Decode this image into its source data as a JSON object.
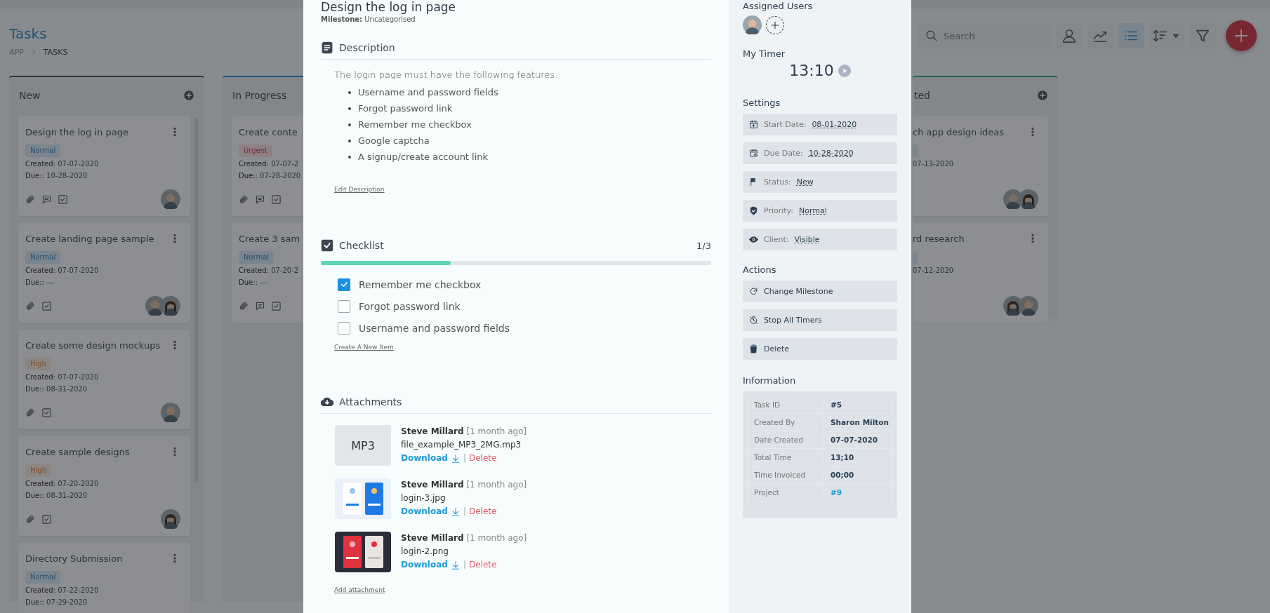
{
  "page_title": "Tasks",
  "breadcrumb": [
    {
      "label": "APP",
      "selected": false
    },
    {
      "label": "TASKS",
      "selected": true
    }
  ],
  "search": {
    "placeholder": "Search"
  },
  "view_buttons": [
    {
      "kind": "users",
      "selected": false
    },
    {
      "kind": "chart",
      "selected": false
    },
    {
      "kind": "list",
      "selected": true
    },
    {
      "kind": "sort",
      "selected": false
    },
    {
      "kind": "filter",
      "selected": false
    }
  ],
  "columns": [
    {
      "title": "New",
      "kind": "new",
      "add": true,
      "cards": [
        {
          "title": "Design the log in page",
          "menu": true,
          "tag": {
            "label": "Normal",
            "kind": "normal"
          },
          "created_label": "Created:",
          "created": "07-07-2020",
          "due_label": "Due::",
          "due": "10-28-2020",
          "attachments": true,
          "comments": true,
          "checklist": true,
          "avatars": [
            {
              "kind": "man"
            }
          ]
        },
        {
          "title": "Create landing page sample",
          "menu": true,
          "tag": {
            "label": "Normal",
            "kind": "normal"
          },
          "created_label": "Created:",
          "created": "07-07-2020",
          "due_label": "Due::",
          "due": "---",
          "attachments": true,
          "comments": false,
          "checklist": true,
          "avatars": [
            {
              "kind": "man"
            },
            {
              "kind": "woman"
            }
          ]
        },
        {
          "title": "Create some design mockups",
          "menu": true,
          "tag": {
            "label": "High",
            "kind": "high"
          },
          "created_label": "Created:",
          "created": "07-07-2020",
          "due_label": "Due::",
          "due": "08-31-2020",
          "attachments": true,
          "comments": false,
          "checklist": true,
          "avatars": [
            {
              "kind": "man"
            }
          ]
        },
        {
          "title": "Create sample designs",
          "menu": true,
          "tag": {
            "label": "High",
            "kind": "high"
          },
          "created_label": "Created:",
          "created": "07-20-2020",
          "due_label": "Due::",
          "due": "08-31-2020",
          "attachments": true,
          "comments": false,
          "checklist": true,
          "avatars": [
            {
              "kind": "woman"
            }
          ]
        },
        {
          "title": "Directory Submission",
          "menu": true,
          "tag": {
            "label": "Normal",
            "kind": "normal"
          },
          "created_label": "Created:",
          "created": "07-22-2020",
          "due_label": "Due::",
          "due": "07-29-2020"
        }
      ]
    },
    {
      "title": "In Progress",
      "kind": "active",
      "cards": [
        {
          "title": "Create conte",
          "tag": {
            "label": "Urgent",
            "kind": "urgent"
          },
          "created_label": "Created:",
          "created": "07-07-2",
          "due_label": "Due::",
          "due": "07-28-2020",
          "attachments": true,
          "comments": true,
          "checklist": true
        },
        {
          "title": "Create 3 sam",
          "tag": {
            "label": "Normal",
            "kind": "normal"
          },
          "created_label": "Created:",
          "created": "07-20-2",
          "due_label": "Due::",
          "due": "---",
          "attachments": true,
          "comments": true,
          "checklist": true
        }
      ]
    },
    {
      "title": "ted",
      "kind": "done",
      "add": true,
      "cards": [
        {
          "title": "ch app design ideas",
          "menu": true,
          "tag": {
            "kind": "normal"
          },
          "created": "07-13-2020",
          "avatars": [
            {
              "kind": "man"
            },
            {
              "kind": "woman"
            }
          ]
        },
        {
          "title": "rd research",
          "menu": true,
          "tag": {
            "kind": "normal"
          },
          "created": "07-12-2020",
          "avatars": [
            {
              "kind": "woman"
            },
            {
              "kind": "man"
            }
          ]
        }
      ]
    }
  ],
  "task": {
    "title": "Design the log in page",
    "milestone": "**Milestone:** Uncategorised",
    "description": {
      "heading": "Description",
      "intro": "The login page must have the following features:",
      "items": [
        "Username and password fields",
        "Forgot password link",
        "Remember me checkbox",
        "Google captcha",
        "A signup/create account link"
      ],
      "edit_link": "Edit Description"
    },
    "checklist": {
      "heading": "Checklist",
      "count": "1/3",
      "level": 0.333,
      "items": [
        {
          "label": "Remember me checkbox",
          "checked": true
        },
        {
          "label": "Forgot password link",
          "checked": false
        },
        {
          "label": "Username and password fields",
          "checked": false
        }
      ],
      "add_link": "Create A New Item"
    },
    "attachments": {
      "heading": "Attachments",
      "items": [
        {
          "kind": "audio",
          "thumb_label": "MP3",
          "author": "Steve Millard",
          "time": "[1 month ago]",
          "file": "file_example_MP3_2MG.mp3",
          "download": "Download",
          "separator": "|",
          "delete": "Delete"
        },
        {
          "kind": "light",
          "author": "Steve Millard",
          "time": "[1 month ago]",
          "file": "login-3.jpg",
          "download": "Download",
          "separator": "|",
          "delete": "Delete"
        },
        {
          "kind": "dark",
          "author": "Steve Millard",
          "time": "[1 month ago]",
          "file": "login-2.png",
          "download": "Download",
          "separator": "|",
          "delete": "Delete"
        }
      ],
      "add_link": "Add attachment"
    }
  },
  "sidebar": {
    "assigned": {
      "heading": "Assigned Users",
      "avatars": [
        {
          "kind": "man"
        }
      ]
    },
    "timer": {
      "heading": "My Timer",
      "time": "13:10"
    },
    "settings": {
      "heading": "Settings",
      "rows": [
        {
          "kind": "start",
          "label": "Start Date:",
          "value": "08-01-2020"
        },
        {
          "kind": "due",
          "label": "Due Date:",
          "value": "10-28-2020"
        },
        {
          "kind": "status",
          "label": "Status:",
          "value": "New"
        },
        {
          "kind": "priority",
          "label": "Priority:",
          "value": "Normal"
        },
        {
          "kind": "client",
          "label": "Client:",
          "value": "Visible"
        }
      ]
    },
    "actions": {
      "heading": "Actions",
      "buttons": [
        {
          "kind": "milestone",
          "label": "Change Milestone"
        },
        {
          "kind": "timers",
          "label": "Stop All Timers"
        },
        {
          "kind": "delete",
          "label": "Delete"
        }
      ]
    },
    "information": {
      "heading": "Information",
      "rows": [
        {
          "label": "Task ID",
          "value": "#5",
          "kind": "text"
        },
        {
          "label": "Created By",
          "value": "Sharon Milton",
          "kind": "text"
        },
        {
          "label": "Date Created",
          "value": "07-07-2020",
          "kind": "text"
        },
        {
          "label": "Total Time",
          "value": "13;10",
          "kind": "text"
        },
        {
          "label": "Time Invoiced",
          "value": "00;00",
          "kind": "text"
        },
        {
          "label": "Project",
          "value": "#9",
          "kind": "link"
        }
      ]
    }
  }
}
